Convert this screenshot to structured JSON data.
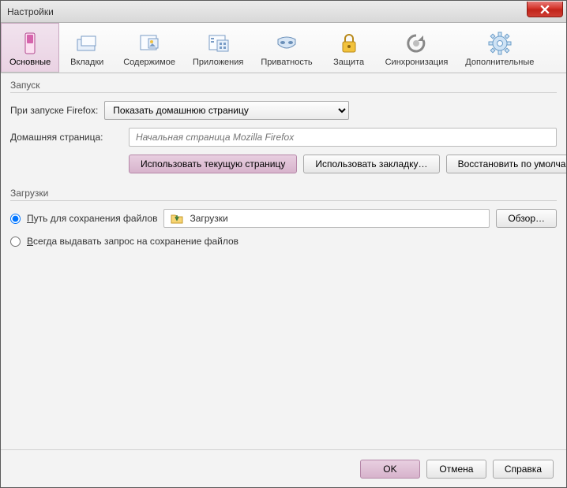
{
  "window": {
    "title": "Настройки"
  },
  "toolbar": {
    "items": [
      {
        "label": "Основные",
        "icon": "switch-icon"
      },
      {
        "label": "Вкладки",
        "icon": "tabs-icon"
      },
      {
        "label": "Содержимое",
        "icon": "content-icon"
      },
      {
        "label": "Приложения",
        "icon": "apps-icon"
      },
      {
        "label": "Приватность",
        "icon": "mask-icon"
      },
      {
        "label": "Защита",
        "icon": "lock-icon"
      },
      {
        "label": "Синхронизация",
        "icon": "sync-icon"
      },
      {
        "label": "Дополнительные",
        "icon": "gear-icon"
      }
    ],
    "active_index": 0
  },
  "startup": {
    "group_label": "Запуск",
    "launch_label": "При запуске Firefox:",
    "launch_options": [
      "Показать домашнюю страницу"
    ],
    "launch_selected": "Показать домашнюю страницу",
    "homepage_label": "Домашняя страница:",
    "homepage_placeholder": "Начальная страница Mozilla Firefox",
    "btn_use_current": "Использовать текущую страницу",
    "btn_use_bookmark": "Использовать закладку…",
    "btn_restore_default": "Восстановить по умолчанию"
  },
  "downloads": {
    "group_label": "Загрузки",
    "radio_save_to": "Путь для сохранения файлов",
    "radio_save_to_key": "П",
    "path_value": "Загрузки",
    "browse_btn": "Обзор…",
    "radio_ask": "Всегда выдавать запрос на сохранение файлов",
    "radio_ask_key": "В",
    "selected_radio": "save_to"
  },
  "footer": {
    "ok": "OK",
    "cancel": "Отмена",
    "help": "Справка"
  }
}
